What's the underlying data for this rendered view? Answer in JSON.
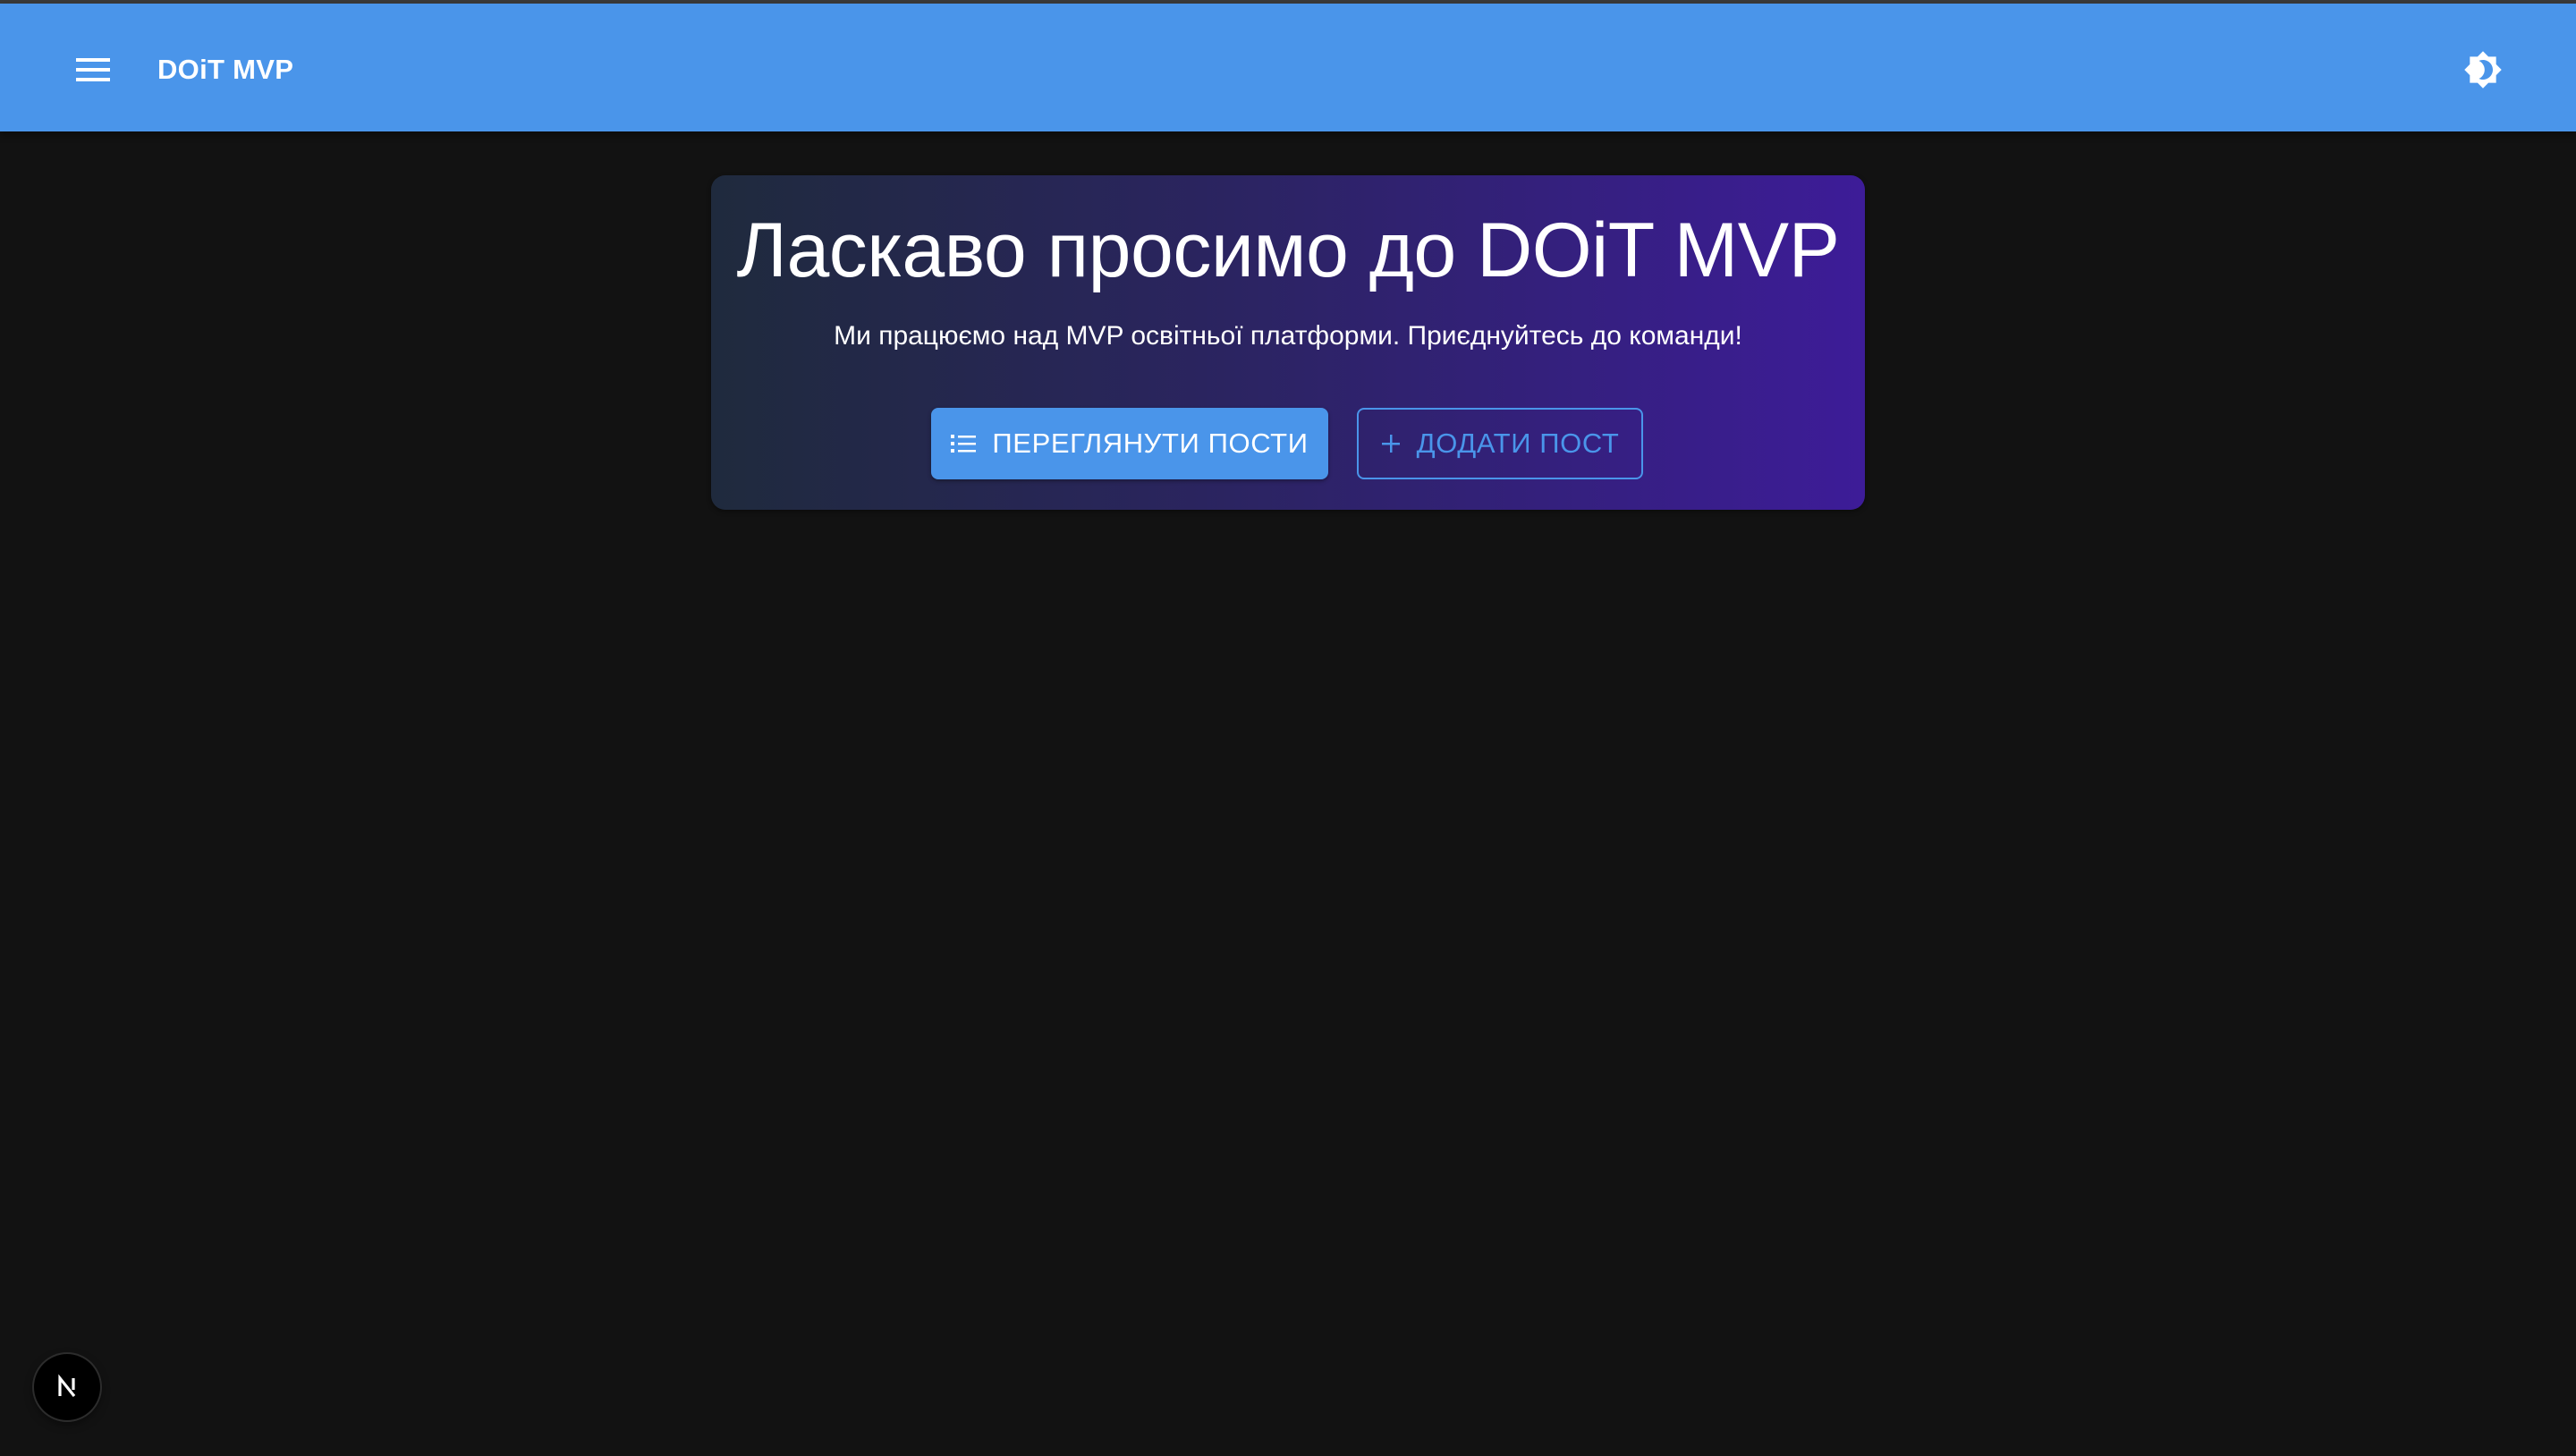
{
  "appbar": {
    "title": "DOiT MVP",
    "color": "#4a95ea",
    "menu_icon": "menu-icon",
    "theme_icon": "brightness-icon"
  },
  "hero": {
    "title": "Ласкаво просимо до DOiT MVP",
    "subtitle": "Ми працюємо над MVP освітньої платформи. Приєднуйтесь до команди!",
    "primary_button": {
      "label": "ПЕРЕГЛЯНУТИ ПОСТИ",
      "icon": "list-icon"
    },
    "secondary_button": {
      "label": "ДОДАТИ ПОСТ",
      "icon": "plus-icon"
    },
    "gradient_start": "#1f2a3d",
    "gradient_end": "#3d1c98"
  },
  "badge": {
    "icon": "nextjs-icon"
  },
  "colors": {
    "background": "#121212",
    "accent": "#4a95ea"
  }
}
